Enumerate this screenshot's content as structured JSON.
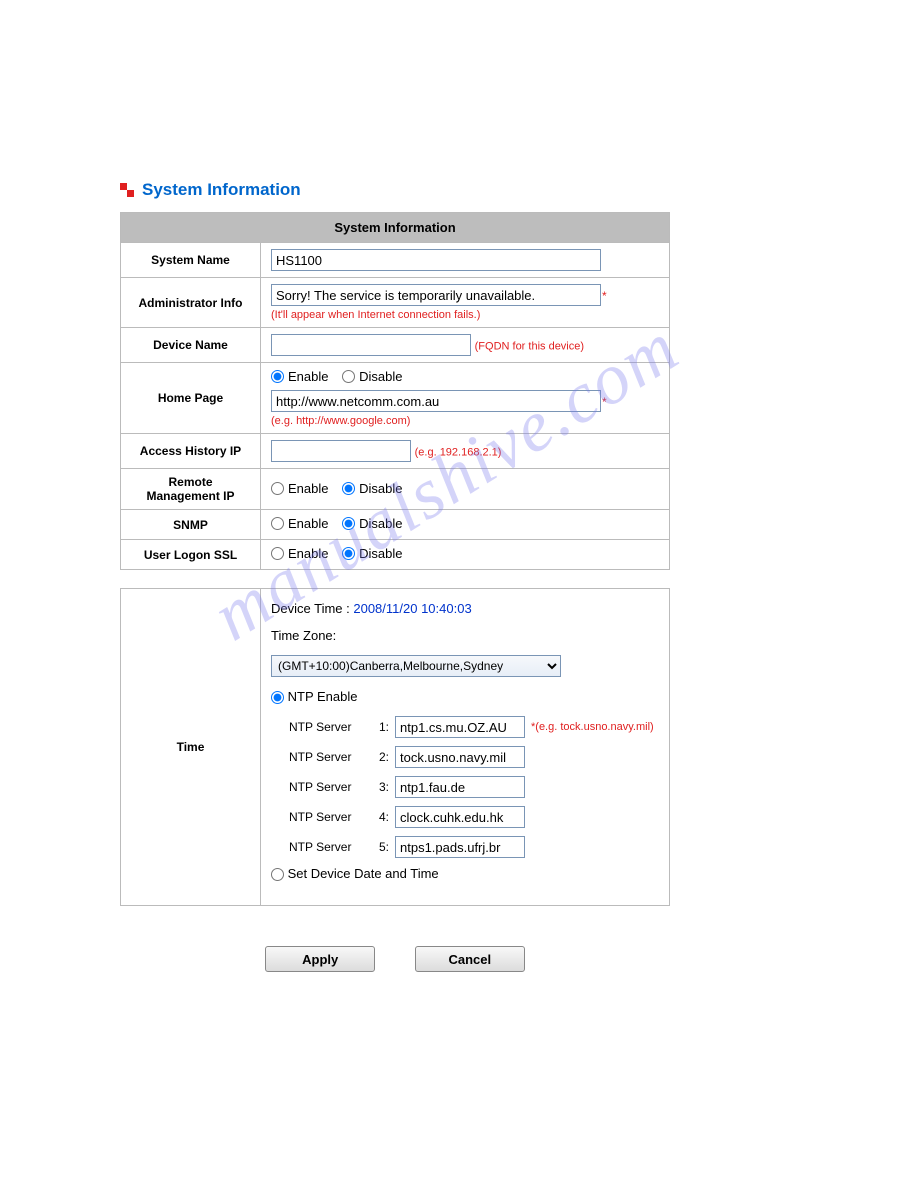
{
  "header": {
    "title": "System Information"
  },
  "tableHeader": "System Information",
  "labels": {
    "systemName": "System Name",
    "adminInfo": "Administrator Info",
    "deviceName": "Device Name",
    "homePage": "Home Page",
    "accessHistoryIp": "Access History IP",
    "remoteMgmtIp": "Remote Management IP",
    "snmp": "SNMP",
    "userLogonSsl": "User Logon SSL",
    "time": "Time",
    "enable": "Enable",
    "disable": "Disable",
    "deviceTimeLabel": "Device Time : ",
    "timeZone": "Time Zone:",
    "ntpEnable": "NTP Enable",
    "ntpServer": "NTP Server",
    "setDeviceDate": "Set Device Date and Time"
  },
  "values": {
    "systemName": "HS1100",
    "adminInfo": "Sorry! The service is temporarily unavailable.",
    "deviceName": "",
    "homePageUrl": "http://www.netcomm.com.au",
    "accessHistoryIp": "",
    "deviceTime": "2008/11/20 10:40:03",
    "timezone": "(GMT+10:00)Canberra,Melbourne,Sydney",
    "ntp1": "ntp1.cs.mu.OZ.AU",
    "ntp2": "tock.usno.navy.mil",
    "ntp3": "ntp1.fau.de",
    "ntp4": "clock.cuhk.edu.hk",
    "ntp5": "ntps1.pads.ufrj.br"
  },
  "hints": {
    "adminInfo": "(It'll appear when Internet connection fails.)",
    "deviceName": "(FQDN for this device)",
    "homePage": "(e.g. http://www.google.com)",
    "accessHistoryIp": "(e.g. 192.168.2.1)",
    "ntp": "*(e.g. tock.usno.navy.mil)"
  },
  "numbers": {
    "n1": "1:",
    "n2": "2:",
    "n3": "3:",
    "n4": "4:",
    "n5": "5:"
  },
  "buttons": {
    "apply": "Apply",
    "cancel": "Cancel"
  },
  "watermark": "manualshive.com"
}
